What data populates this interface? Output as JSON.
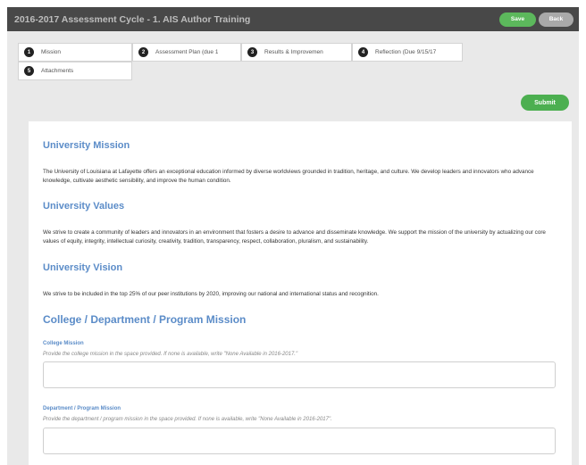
{
  "header": {
    "title": "2016-2017 Assessment Cycle - 1. AIS Author Training",
    "save_label": "Save",
    "back_label": "Back"
  },
  "tabs": [
    {
      "number": "1",
      "label": "Mission"
    },
    {
      "number": "2",
      "label": "Assessment Plan (due 1"
    },
    {
      "number": "3",
      "label": "Results & Improvemen"
    },
    {
      "number": "4",
      "label": "Reflection (Due 9/15/17"
    },
    {
      "number": "5",
      "label": "Attachments"
    }
  ],
  "submit_label": "Submit",
  "sections": {
    "mission_heading": "University Mission",
    "mission_text": "The University of Louisiana at Lafayette offers an exceptional education informed by diverse worldviews grounded in tradition, heritage, and culture. We develop leaders and innovators who advance knowledge, cultivate aesthetic sensibility, and improve the human condition.",
    "values_heading": "University Values",
    "values_text": "We strive to create a community of leaders and innovators in an environment that fosters a desire to advance and disseminate knowledge. We support the mission of the university by actualizing our core values of equity, integrity, intellectual curiosity, creativity, tradition, transparency, respect, collaboration, pluralism, and sustainability.",
    "vision_heading": "University Vision",
    "vision_text": "We strive to be included in the top 25% of our peer institutions by 2020, improving our national and international status and recognition.",
    "cdp_heading": "College / Department / Program Mission"
  },
  "fields": {
    "college_label": "College Mission",
    "college_help": "Provide the college mission in the space provided. If none is available, write \"None Available in 2016-2017.\"",
    "college_value": "",
    "dept_label": "Department / Program Mission",
    "dept_help": "Provide the department / program mission in the space provided. If none is available, write \"None Available in 2016-2017\".",
    "dept_value": ""
  }
}
